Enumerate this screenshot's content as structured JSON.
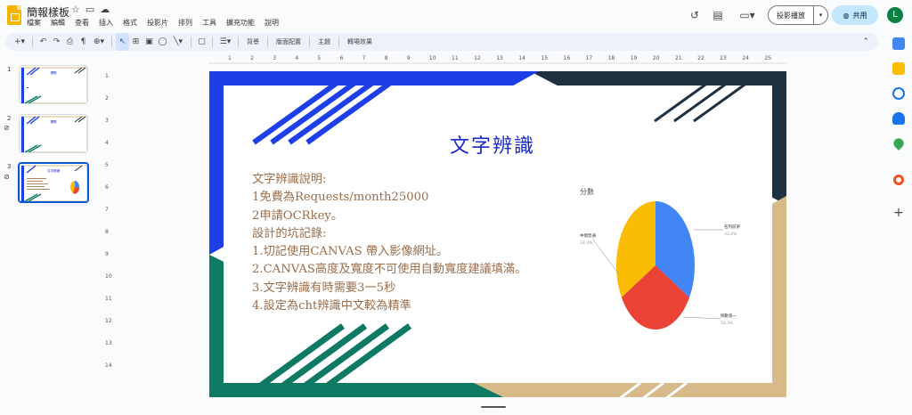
{
  "header": {
    "doc_title": "簡報樣板",
    "menu": [
      "檔案",
      "編輯",
      "查看",
      "插入",
      "格式",
      "投影片",
      "排列",
      "工具",
      "擴充功能",
      "說明"
    ],
    "present_label": "投影播放",
    "share_label": "共用",
    "avatar_letter": "L"
  },
  "toolbar": {
    "background_label": "背景",
    "layout_label": "版面配置",
    "theme_label": "主題",
    "transition_label": "轉場效果"
  },
  "filmstrip": {
    "slides": [
      {
        "number": "1",
        "title": "標題"
      },
      {
        "number": "2",
        "title": "標題"
      },
      {
        "number": "3",
        "title": "文字辨識"
      }
    ]
  },
  "ruler": {
    "horizontal": [
      "1",
      "2",
      "3",
      "4",
      "5",
      "6",
      "7",
      "8",
      "9",
      "10",
      "11",
      "12",
      "13",
      "14",
      "15",
      "16",
      "17",
      "18",
      "19",
      "20",
      "21",
      "22",
      "23",
      "24",
      "25"
    ],
    "vertical": [
      "1",
      "2",
      "3",
      "4",
      "5",
      "6",
      "7",
      "8",
      "9",
      "10",
      "11",
      "12",
      "13",
      "14"
    ]
  },
  "slide": {
    "title": "文字辨識",
    "body_lines": [
      "文字辨識說明:",
      "1免費為Requests/month25000",
      "2申請OCRkey。",
      "設計的坑記錄:",
      "1.切記使用CANVAS 帶入影像網址。",
      "2.CANVAS高度及寬度不可使用自動寬度建議填滿。",
      "3.文字辨識有時需要3一5秒",
      "4.設定為cht辨識中文較為精準"
    ]
  },
  "chart_data": {
    "type": "pie",
    "title": "分數",
    "slices": [
      {
        "label": "名列前茅",
        "value": 33.4,
        "color": "#4285f4"
      },
      {
        "label": "倒數第一",
        "value": 33.3,
        "color": "#ea4335"
      },
      {
        "label": "中間普通",
        "value": 33.3,
        "color": "#fbbc04"
      }
    ],
    "pct_labels": [
      "33.4%",
      "33.3%",
      "33.3%"
    ]
  },
  "colors": {
    "accent": "#0b57d0",
    "slide_title": "#1a29c9",
    "slide_body": "#9b6d4a"
  }
}
